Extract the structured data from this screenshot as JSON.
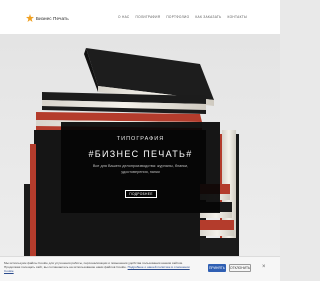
{
  "header": {
    "logo_text": "Бизнес Печать",
    "nav": [
      "О НАС",
      "ПОЛИГРАФИЯ",
      "ПОРТФОЛИО",
      "КАК ЗАКАЗАТЬ",
      "КОНТАКТЫ"
    ]
  },
  "hero": {
    "kicker": "ТИПОГРАФИЯ",
    "title": "#БИЗНЕС ПЕЧАТЬ#",
    "subtitle": "Все для Вашего делопроизводства: журналы, бланки, удостоверения, папки",
    "button": "ПОДРОБНЕЕ"
  },
  "cookie": {
    "text": "Мы используем файлы Cookie для улучшения работы, персонализации и повышения удобства пользования нашим сайтом. Продолжая посещать сайт, вы соглашаетесь на использование нами файлов Cookie.",
    "link": "Подробнее о нашей политике в отношении Cookie",
    "accept": "ПРИНЯТЬ",
    "decline": "ОТКЛОНИТЬ",
    "close": "×"
  },
  "colors": {
    "accent": "#f0a020",
    "book_red": "#b8402f",
    "book_dark": "#1c1c1c",
    "button": "#2f5fb3"
  }
}
